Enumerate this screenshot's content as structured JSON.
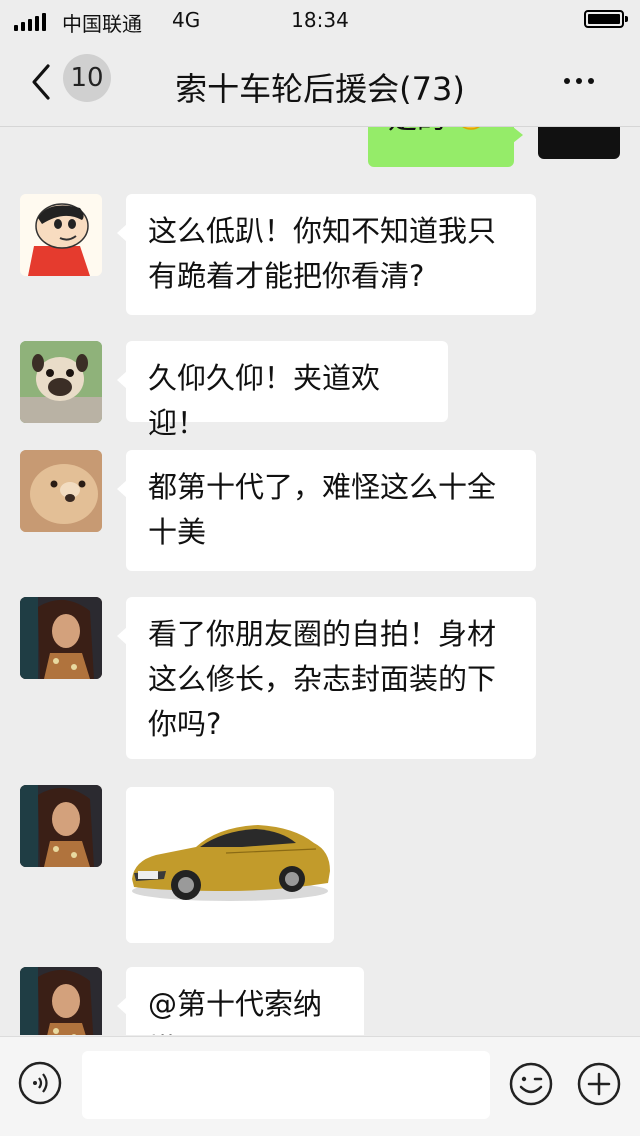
{
  "status_bar": {
    "carrier": "中国联通",
    "network": "4G",
    "time": "18:34"
  },
  "header": {
    "back_count": "10",
    "title": "索十车轮后援会(73)"
  },
  "partial_message": "是的",
  "messages": [
    {
      "text": "这么低趴！你知不知道我只有跪着才能把你看清?"
    },
    {
      "text": "久仰久仰！夹道欢迎！"
    },
    {
      "text": "都第十代了，难怪这么十全十美"
    },
    {
      "text": "看了你朋友圈的自拍！身材这么修长，杂志封面装的下你吗?"
    },
    {
      "image": "gold-sedan-photo"
    },
    {
      "text": "@第十代索纳塔"
    }
  ],
  "input_bar": {
    "placeholder": ""
  },
  "colors": {
    "background": "#ededed",
    "bubble_in": "#ffffff",
    "bubble_out": "#95ec69",
    "car": "#c29b2b"
  }
}
